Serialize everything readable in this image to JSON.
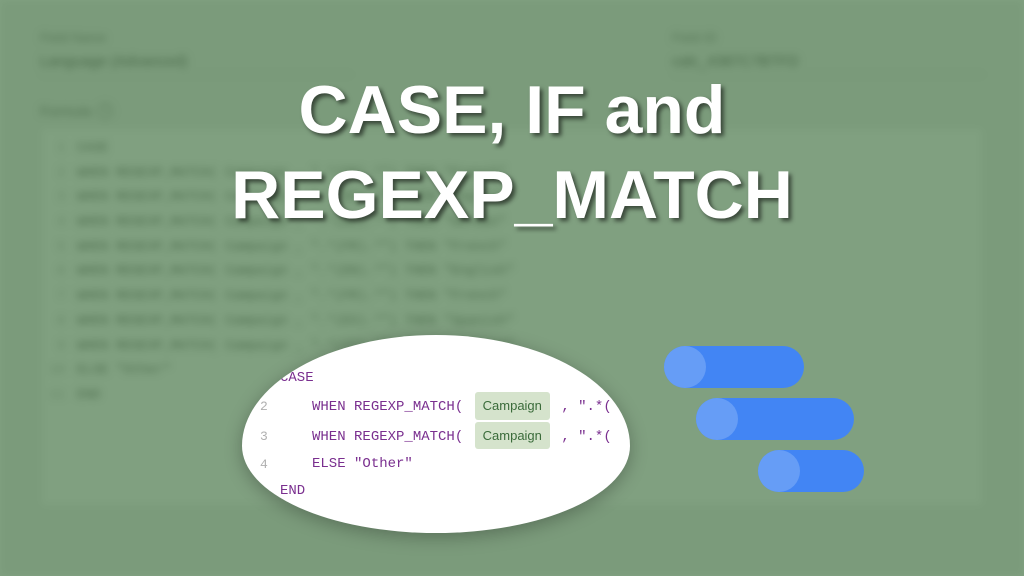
{
  "background": {
    "fieldNameLabel": "Field Name",
    "fieldName": "Language (Advanced)",
    "fieldIdLabel": "Field ID",
    "fieldId": "calc_4387C7BTFD",
    "formulaLabel": "Formula",
    "lines": [
      "CASE",
      "WHEN REGEXP_MATCH( Campaign , \".*(FR).*\") THEN \"French\"",
      "WHEN REGEXP_MATCH( Campaign , \".*(EN).*\") THEN \"English\"",
      "WHEN REGEXP_MATCH( Campaign , \".*(DE).*\") THEN \"German\"",
      "WHEN REGEXP_MATCH( Campaign , \".*(FR).*\") THEN \"French\"",
      "WHEN REGEXP_MATCH( Campaign , \".*(EN).*\") THEN \"English\"",
      "WHEN REGEXP_MATCH( Campaign , \".*(FR).*\") THEN \"French\"",
      "WHEN REGEXP_MATCH( Campaign , \".*(ES).*\") THEN \"Spanish\"",
      "WHEN REGEXP_MATCH( Campaign , \".*(IT).*\") THEN \"Italian\"",
      "ELSE \"Other\"",
      "END"
    ]
  },
  "title": {
    "line1": "CASE, IF and",
    "line2": "REGEXP_MATCH"
  },
  "bubble": {
    "line1_kw": "CASE",
    "line2_kw": "WHEN",
    "line2_fn": "REGEXP_MATCH(",
    "line2_chip": "Campaign",
    "line2_tail": ", \".*(",
    "line3_kw": "WHEN",
    "line3_fn": "REGEXP_MATCH(",
    "line3_chip": "Campaign",
    "line3_tail": ", \".*(",
    "line4_kw": "ELSE",
    "line4_str": "\"Other\"",
    "line5_kw": "END"
  }
}
